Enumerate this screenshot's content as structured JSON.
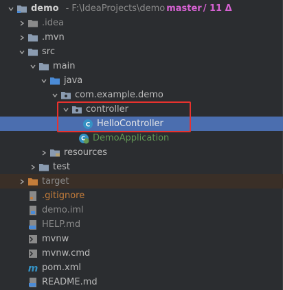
{
  "root": {
    "name": "demo",
    "path": "- F:\\IdeaProjects\\demo",
    "branch": "master",
    "changes": "/ 11 Δ"
  },
  "items": [
    {
      "label": ".idea"
    },
    {
      "label": ".mvn"
    },
    {
      "label": "src"
    },
    {
      "label": "main"
    },
    {
      "label": "java"
    },
    {
      "label": "com.example.demo"
    },
    {
      "label": "controller"
    },
    {
      "label": "HelloController"
    },
    {
      "label": "DemoApplication"
    },
    {
      "label": "resources"
    },
    {
      "label": "test"
    },
    {
      "label": "target"
    },
    {
      "label": ".gitignore"
    },
    {
      "label": "demo.iml"
    },
    {
      "label": "HELP.md"
    },
    {
      "label": "mvnw"
    },
    {
      "label": "mvnw.cmd"
    },
    {
      "label": "pom.xml"
    },
    {
      "label": "README.md"
    }
  ],
  "colors": {
    "selection": "#4b6eaf",
    "highlight_border": "#e8322e",
    "branch": "#d662d2",
    "spring_green": "#629755",
    "excluded_orange": "#c57d3a"
  },
  "icons": {
    "folder": "folder-icon",
    "package": "package-icon",
    "java_class": "java-class-icon",
    "spring_boot": "spring-boot-icon",
    "file": "file-icon"
  }
}
